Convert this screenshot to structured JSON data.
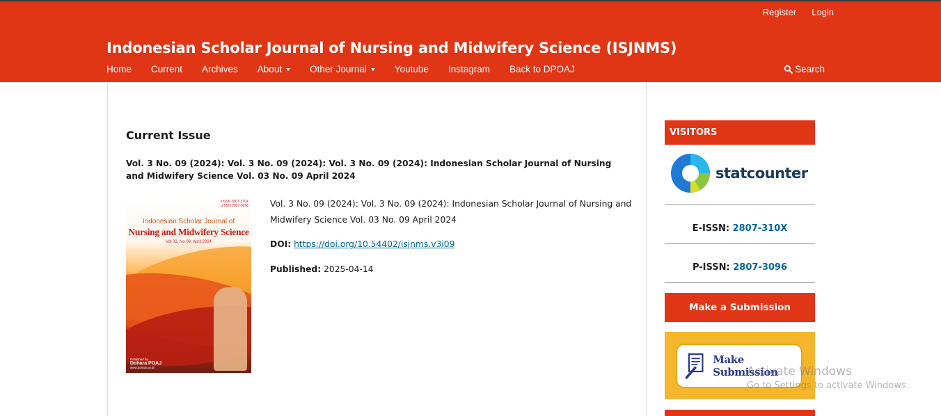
{
  "header": {
    "user_nav": [
      "Register",
      "Login"
    ],
    "site_title": "Indonesian Scholar Journal of Nursing and Midwifery Science (ISJNMS)",
    "nav": [
      {
        "label": "Home",
        "dropdown": false
      },
      {
        "label": "Current",
        "dropdown": false
      },
      {
        "label": "Archives",
        "dropdown": false
      },
      {
        "label": "About",
        "dropdown": true
      },
      {
        "label": "Other Journal",
        "dropdown": true
      },
      {
        "label": "Youtube",
        "dropdown": false
      },
      {
        "label": "Instagram",
        "dropdown": false
      },
      {
        "label": "Back to DPOAJ",
        "dropdown": false
      }
    ],
    "search_label": "Search",
    "search_icon": "search-icon"
  },
  "main": {
    "heading": "Current Issue",
    "issue_title": "Vol. 3 No. 09 (2024): Vol. 3 No. 09 (2024): Vol. 3 No. 09 (2024): Indonesian Scholar Journal of Nursing and Midwifery Science Vol. 03 No. 09 April 2024",
    "cover": {
      "issn_lines": [
        "eISSN 2807-310X",
        "pISSN 2807-3096"
      ],
      "title_small": "Indonesian Scholar Journal of",
      "title_big": "Nursing and Midwifery Science",
      "vol": "Vol 03, No 09, April 2024",
      "publisher_line": "Published by",
      "publisher": "Dohara POAJ",
      "publisher_url": "www.dohara.or.id"
    },
    "description": "Vol. 3 No. 09 (2024): Vol. 3 No. 09 (2024): Indonesian Scholar Journal of Nursing and Midwifery Science Vol. 03 No. 09 April 2024",
    "doi_label": "DOI:",
    "doi_value": "https://doi.org/10.54402/isjnms.v3i09",
    "published_label": "Published:",
    "published_value": "2025-04-14"
  },
  "sidebar": {
    "visitors_title": "VISITORS",
    "statcounter_label": "statcounter",
    "eissn_label": "E-ISSN:",
    "eissn_value": "2807-310X",
    "pissn_label": "P-ISSN:",
    "pissn_value": "2807-3096",
    "submit_button": "Make a Submission",
    "submit_banner": "Make Submission"
  },
  "overlay": {
    "line1": "Activate Windows",
    "line2": "Go to Settings to activate Windows."
  },
  "colors": {
    "brand_red": "#e03616",
    "link_blue": "#006798",
    "banner_yellow": "#f4b62a"
  }
}
